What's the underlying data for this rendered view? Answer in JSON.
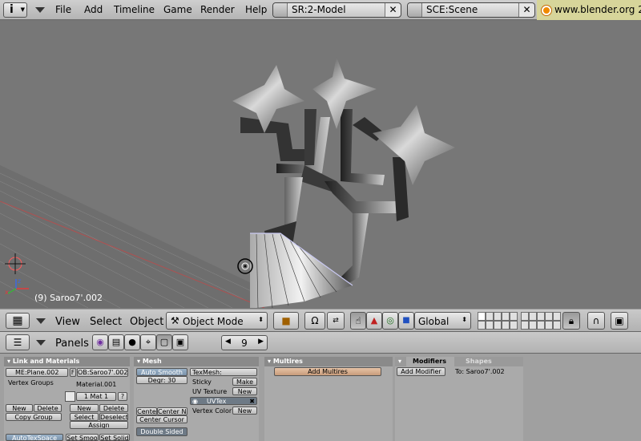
{
  "top_header": {
    "editor_icon": "i",
    "menus": [
      "File",
      "Add",
      "Timeline",
      "Game",
      "Render",
      "Help"
    ],
    "screen_field": "SR:2-Model",
    "scene_field": "SCE:Scene",
    "url": "www.blender.org 2"
  },
  "viewport": {
    "status": "(9) Saroo7'.002",
    "axis_x": "x",
    "axis_z": "z"
  },
  "view_header": {
    "menus": [
      "View",
      "Select",
      "Object"
    ],
    "mode": "Object Mode",
    "orientation": "Global"
  },
  "buttons_header": {
    "panels_label": "Panels",
    "frame": "9"
  },
  "panels": {
    "link_materials": {
      "title": "Link and Materials",
      "me_field": "ME:Plane.002",
      "f_label": "F",
      "ob_field": "OB:Saroo7'.002",
      "vertex_groups": "Vertex Groups",
      "material_name": "Material.001",
      "mat_slot": "1 Mat 1",
      "question": "?",
      "new": "New",
      "delete": "Delete",
      "copy_group": "Copy Group",
      "mat_new": "New",
      "mat_delete": "Delete",
      "select": "Select",
      "deselect": "Deselect",
      "assign": "Assign",
      "autotex_space": "AutoTexSpace",
      "set_smooth": "Set Smoo",
      "set_solid": "Set Solid"
    },
    "mesh": {
      "title": "Mesh",
      "auto_smooth": "Auto Smooth",
      "degr": "Degr: 30",
      "centre": "Cente",
      "center_new": "Center Ne",
      "center_cursor": "Center Cursor",
      "double_sided": "Double Sided",
      "texmesh": "TexMesh:",
      "sticky": "Sticky",
      "make": "Make",
      "uv_texture": "UV Texture",
      "uv_new": "New",
      "uvtex": "UVTex",
      "vertex_color": "Vertex Color",
      "vc_new": "New"
    },
    "multires": {
      "title": "Multires",
      "add_multires": "Add Multires"
    },
    "modifiers": {
      "tab_modifiers": "Modifiers",
      "tab_shapes": "Shapes",
      "add_modifier": "Add Modifier",
      "to_label": "To: Saroo7'.002"
    }
  }
}
